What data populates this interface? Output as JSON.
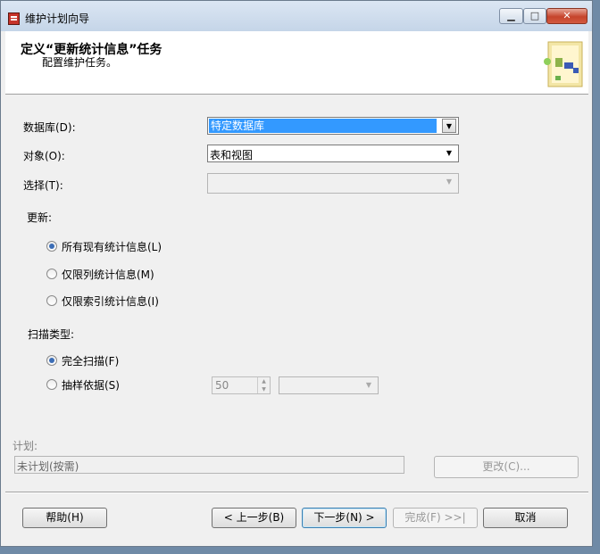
{
  "window": {
    "title": "维护计划向导"
  },
  "header": {
    "title": "定义“更新统计信息”任务",
    "subtitle": "配置维护任务。"
  },
  "form": {
    "database_label": "数据库(D):",
    "database_value": "特定数据库",
    "object_label": "对象(O):",
    "object_value": "表和视图",
    "selection_label": "选择(T):",
    "selection_value": "",
    "update_group_label": "更新:",
    "update_options": [
      {
        "label": "所有现有统计信息(L)",
        "selected": true
      },
      {
        "label": "仅限列统计信息(M)",
        "selected": false
      },
      {
        "label": "仅限索引统计信息(I)",
        "selected": false
      }
    ],
    "scan_group_label": "扫描类型:",
    "scan_options": [
      {
        "label": "完全扫描(F)",
        "selected": true
      },
      {
        "label": "抽样依据(S)",
        "selected": false
      }
    ],
    "sample_value": "50",
    "sample_unit_value": ""
  },
  "schedule": {
    "label": "计划:",
    "value": "未计划(按需)",
    "change_button": "更改(C)..."
  },
  "footer": {
    "help": "帮助(H)",
    "back": "< 上一步(B)",
    "next": "下一步(N) >",
    "finish": "完成(F) >>|",
    "cancel": "取消"
  },
  "colors": {
    "selection": "#3399ff",
    "radio_dot": "#3b6db6"
  },
  "icons": [
    "wizard-icon",
    "app-icon",
    "minimize-icon",
    "maximize-icon",
    "close-icon"
  ]
}
